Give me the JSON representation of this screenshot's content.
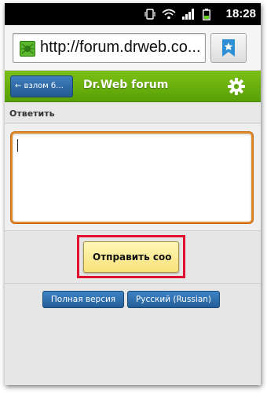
{
  "status_bar": {
    "time": "18:28",
    "icons": [
      "vibrate-icon",
      "wifi-icon",
      "signal-icon",
      "battery-icon"
    ]
  },
  "browser": {
    "url": "http://forum.drweb.co...",
    "favicon": "drweb-spider-icon",
    "bookmark_icon": "bookmark-star-icon"
  },
  "header": {
    "back_label": "← взлом б...",
    "title": "Dr.Web forum",
    "settings_icon": "gear-icon",
    "color": "#6cb010"
  },
  "reply": {
    "section_label": "Ответить",
    "textarea_value": "",
    "submit_label": "Отправить соо"
  },
  "footer": {
    "full_version_label": "Полная версия",
    "language_label": "Русский (Russian)"
  },
  "colors": {
    "highlight": "#e0102f",
    "button_blue": "#2f6fab",
    "submit_yellow": "#fbe98c"
  }
}
